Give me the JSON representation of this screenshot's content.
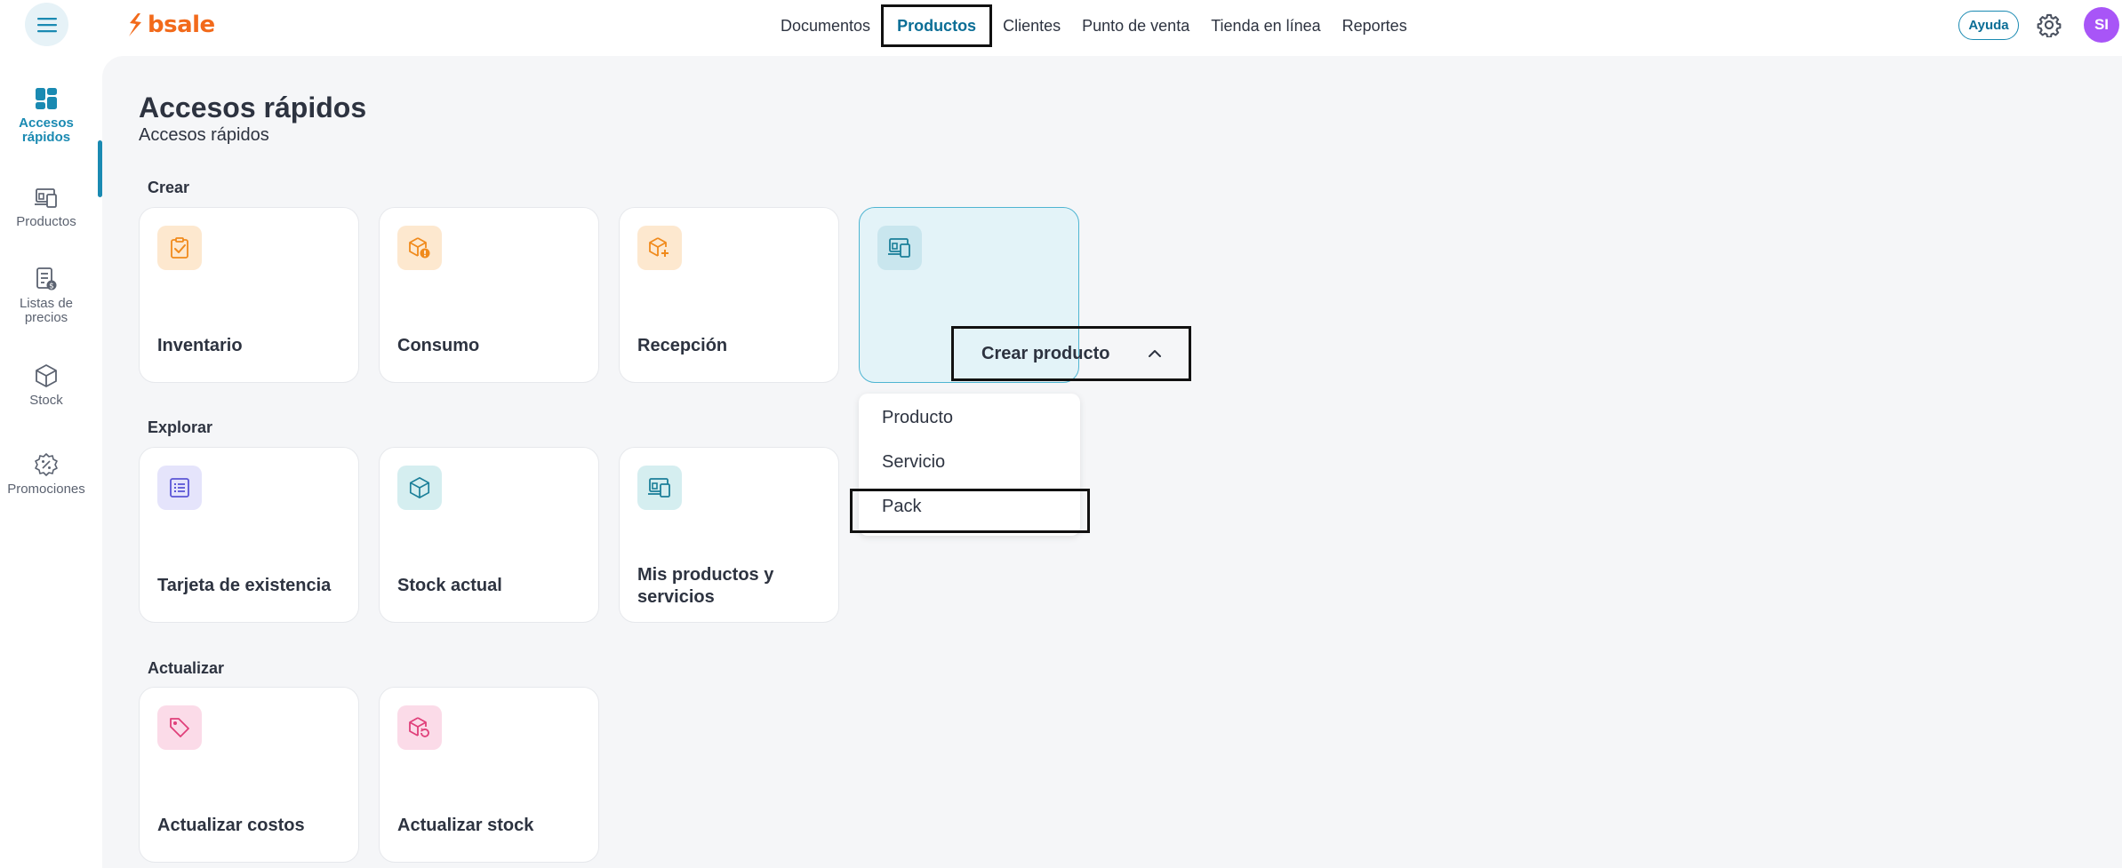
{
  "brand": {
    "name": "bsale",
    "color": "#f26a1b",
    "accent": "#1a8ab2"
  },
  "topnav": {
    "menu_icon": "hamburger-icon",
    "items": [
      {
        "label": "Documentos"
      },
      {
        "label": "Productos",
        "active": true
      },
      {
        "label": "Clientes"
      },
      {
        "label": "Punto de venta"
      },
      {
        "label": "Tienda en línea"
      },
      {
        "label": "Reportes"
      }
    ],
    "help_label": "Ayuda",
    "settings_icon": "gear-icon",
    "avatar_initials": "SI"
  },
  "sidebar": {
    "items": [
      {
        "label": "Accesos rápidos",
        "icon": "dashboard-icon",
        "active": true
      },
      {
        "label": "Productos",
        "icon": "products-icon"
      },
      {
        "label": "Listas de precios",
        "icon": "price-list-icon"
      },
      {
        "label": "Stock",
        "icon": "cube-icon"
      },
      {
        "label": "Promociones",
        "icon": "percent-badge-icon"
      }
    ]
  },
  "page": {
    "title": "Accesos rápidos",
    "subtitle": "Accesos rápidos"
  },
  "sections": {
    "crear": {
      "label": "Crear",
      "cards": [
        {
          "title": "Inventario",
          "icon": "clipboard-check-icon"
        },
        {
          "title": "Consumo",
          "icon": "box-alert-icon"
        },
        {
          "title": "Recepción",
          "icon": "box-plus-icon"
        },
        {
          "title": "Crear producto",
          "icon": "products-icon",
          "expanded": true
        }
      ]
    },
    "explorar": {
      "label": "Explorar",
      "cards": [
        {
          "title": "Tarjeta de existencia",
          "icon": "list-card-icon"
        },
        {
          "title": "Stock actual",
          "icon": "cube-icon"
        },
        {
          "title": "Mis productos y servicios",
          "icon": "products-icon"
        }
      ]
    },
    "actualizar": {
      "label": "Actualizar",
      "cards": [
        {
          "title": "Actualizar costos",
          "icon": "tag-icon"
        },
        {
          "title": "Actualizar stock",
          "icon": "box-refresh-icon"
        }
      ]
    }
  },
  "dropdown": {
    "items": [
      {
        "label": "Producto"
      },
      {
        "label": "Servicio"
      },
      {
        "label": "Pack"
      }
    ]
  }
}
